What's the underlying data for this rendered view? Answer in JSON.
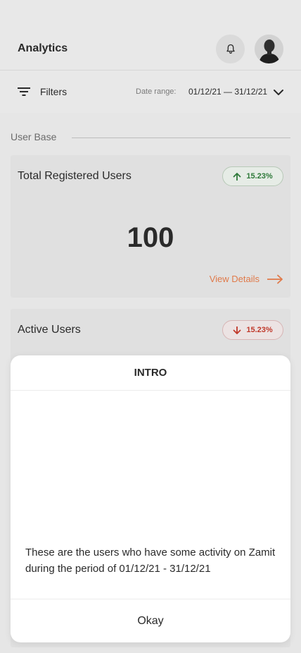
{
  "header": {
    "title": "Analytics",
    "bell_icon": "bell-icon",
    "avatar_icon": "user-avatar"
  },
  "filter_bar": {
    "filters_label": "Filters",
    "date_range_label": "Date range:",
    "date_range_value": "01/12/21 — 31/12/21"
  },
  "section": {
    "label": "User Base"
  },
  "cards": [
    {
      "title": "Total Registered Users",
      "badge": "15.23%",
      "trend": "up",
      "value": "100",
      "link_label": "View Details"
    },
    {
      "title": "Active Users",
      "badge": "15.23%",
      "trend": "down"
    }
  ],
  "modal": {
    "title": "INTRO",
    "body": "These are the users who have some activity on Zamit during the period of 01/12/21 - 31/12/21",
    "button": "Okay"
  },
  "colors": {
    "up": "#2f7a3a",
    "down": "#c0392b",
    "link": "#e07a4a"
  }
}
